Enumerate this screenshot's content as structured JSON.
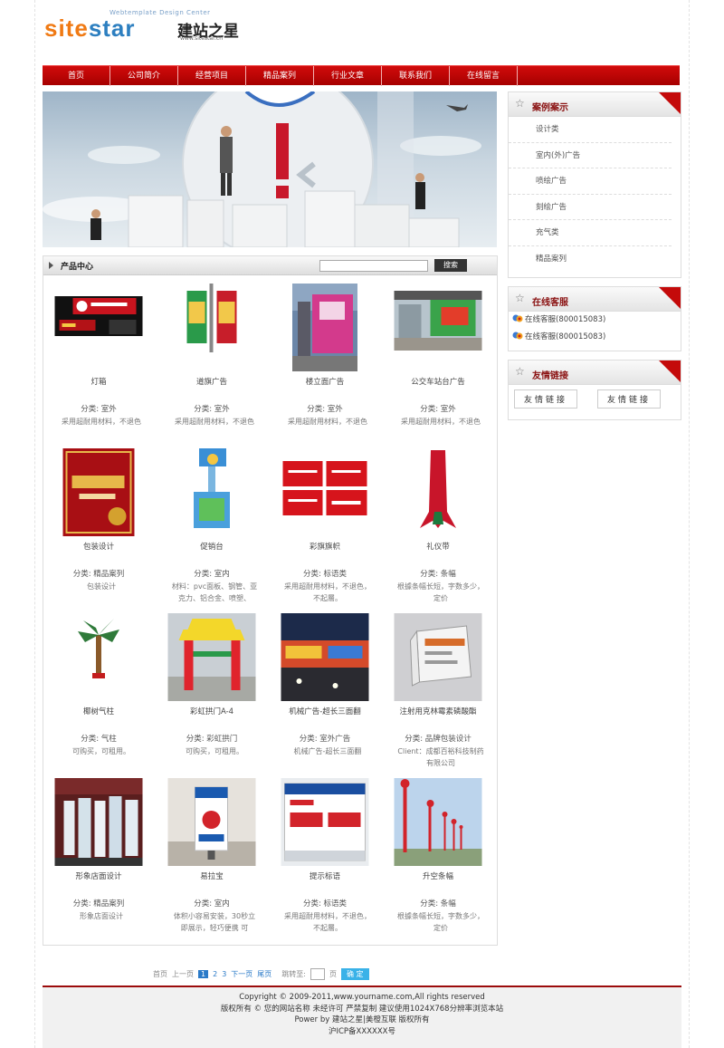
{
  "logo": {
    "word1": "site",
    "word2": "star",
    "cn": "建站之星",
    "sub": "Webtemplate Design Center",
    "url": "www.sitestar.cn"
  },
  "nav": [
    "首页",
    "公司简介",
    "经营项目",
    "精品案列",
    "行业文章",
    "联系我们",
    "在线留言"
  ],
  "products_panel": {
    "title": "产品中心",
    "search_button": "搜索"
  },
  "products": [
    {
      "name": "灯箱",
      "category": "分类: 室外",
      "desc": "采用超耐用材料，不退色"
    },
    {
      "name": "道旗广告",
      "category": "分类: 室外",
      "desc": "采用超耐用材料，不退色"
    },
    {
      "name": "楼立面广告",
      "category": "分类: 室外",
      "desc": "采用超耐用材料，不退色"
    },
    {
      "name": "公交车站台广告",
      "category": "分类: 室外",
      "desc": "采用超耐用材料，不退色"
    },
    {
      "name": "包装设计",
      "category": "分类: 精品案列",
      "desc": "包装设计"
    },
    {
      "name": "促销台",
      "category": "分类: 室内",
      "desc": "材料：pvc面板、钢管、亚克力、铝合金、喷塑、"
    },
    {
      "name": "彩旗旗帜",
      "category": "分类: 标语类",
      "desc": "采用超耐用材料，不退色，不起層。"
    },
    {
      "name": "礼仪带",
      "category": "分类: 条幅",
      "desc": "根據条幅长短，字数多少，定价"
    },
    {
      "name": "椰树气柱",
      "category": "分类: 气柱",
      "desc": "可购买，可租用。"
    },
    {
      "name": "彩虹拱门A-4",
      "category": "分类: 彩虹拱门",
      "desc": "可购买，可租用。"
    },
    {
      "name": "机械广告-超长三面翻",
      "category": "分类: 室外广告",
      "desc": "机械广告-超长三面翻"
    },
    {
      "name": "注射用克林霉素磷酸酯",
      "category": "分类: 品牌包装设计",
      "desc": "Client：成都百裕科技制药有限公司"
    },
    {
      "name": "形象店面设计",
      "category": "分类: 精品案列",
      "desc": "形象店面设计"
    },
    {
      "name": "易拉宝",
      "category": "分类: 室内",
      "desc": "体积小容易安装，30秒立即展示，轻巧便携 可"
    },
    {
      "name": "提示标语",
      "category": "分类: 标语类",
      "desc": "采用超耐用材料，不退色，不起層。"
    },
    {
      "name": "升空条幅",
      "category": "分类: 条幅",
      "desc": "根據条幅长短，字数多少，定价"
    }
  ],
  "pager": {
    "first": "首页",
    "prev": "上一页",
    "current": "1",
    "p2": "2",
    "p3": "3",
    "next": "下一页",
    "last": "尾页",
    "jump": "跳转至:",
    "unit": "页",
    "go": "确 定"
  },
  "sidebar": {
    "cases": {
      "title": "案例案示",
      "items": [
        "设计类",
        "室内(外)广告",
        "喷绘广告",
        "刻绘广告",
        "充气类",
        "精品案列"
      ]
    },
    "service": {
      "title": "在线客服",
      "items": [
        "在线客服(800015083)",
        "在线客服(800015083)"
      ]
    },
    "links": {
      "title": "友情链接",
      "items": [
        "友情链接",
        "友情链接"
      ]
    }
  },
  "footer": {
    "line1": "Copyright © 2009-2011,www.yourname.com,All rights reserved",
    "line2": "版权所有 © 您的网站名称  未经许可  严禁复制  建议使用1024X768分辨率浏览本站",
    "line3": "Power by 建站之星|美橙互联 版权所有",
    "line4": "沪ICP备XXXXXX号"
  },
  "colors": {
    "nav_red": "#c40a0a",
    "accent_blue": "#2a7ac8"
  }
}
